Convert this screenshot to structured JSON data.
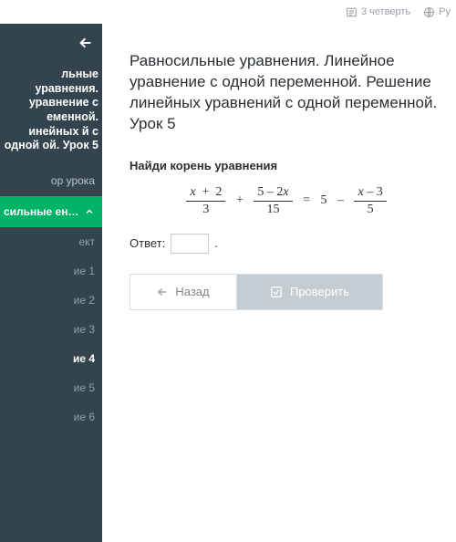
{
  "topbar": {
    "quarter": "3 четверть",
    "lang": "Ру"
  },
  "sidebar": {
    "title": "льные уравнения. уравнение с еменной. инейных й с одной ой. Урок 5",
    "overview": "ор урока",
    "accordion": "сильные ения. Линей...",
    "items": [
      "ект",
      "ие 1",
      "ие 2",
      "ие 3",
      "ие 4",
      "ие 5",
      "ие 6"
    ],
    "activeIndex": 4
  },
  "content": {
    "title": "Равносильные уравнения. Линейное уравнение с одной переменной. Решение линейных уравнений с одной переменной. Урок 5",
    "task": "Найди корень уравнения",
    "answer_label": "Ответ:",
    "answer_value": "",
    "period": ".",
    "back": "Назад",
    "check": "Проверить",
    "equation": {
      "f1n": "x  +  2",
      "f1d": "3",
      "f2n": "5 – 2x",
      "f2d": "15",
      "mid": "5",
      "f3n": "x – 3",
      "f3d": "5"
    }
  }
}
